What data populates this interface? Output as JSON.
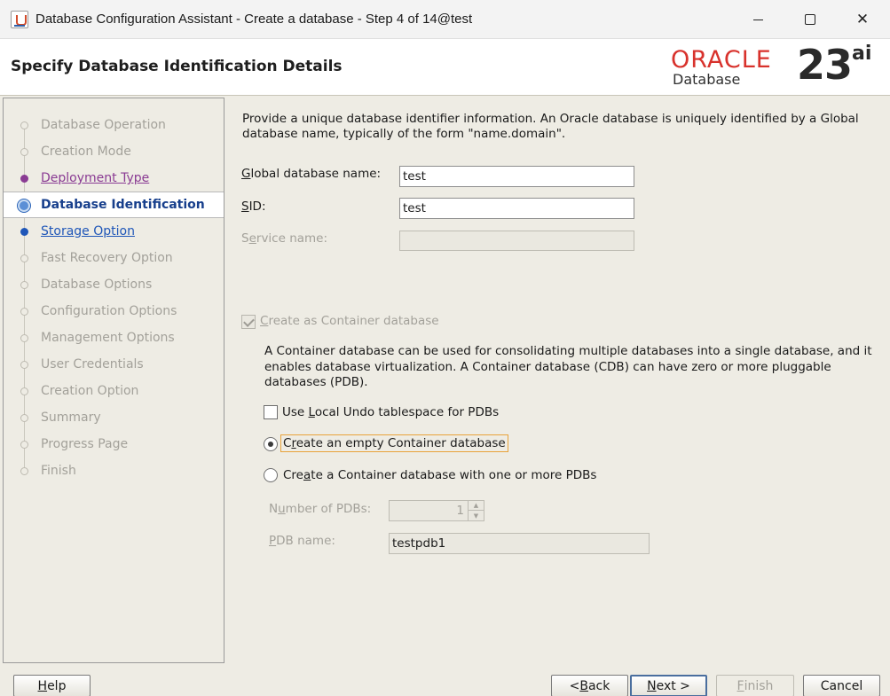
{
  "window": {
    "title": "Database Configuration Assistant - Create a database - Step 4 of 14@test",
    "minimize_glyph": "",
    "close_glyph": "✕"
  },
  "header": {
    "title": "Specify Database Identification Details",
    "logo": {
      "brand": "ORACLE",
      "product": "Database",
      "version": "23",
      "version_suffix": "ai",
      "brand_color": "#d8322c"
    }
  },
  "sidebar": {
    "items": [
      {
        "label": "Database Operation",
        "state": "inactive"
      },
      {
        "label": "Creation Mode",
        "state": "inactive"
      },
      {
        "label": "Deployment Type",
        "state": "visited"
      },
      {
        "label": "Database Identification",
        "state": "current"
      },
      {
        "label": "Storage Option",
        "state": "next"
      },
      {
        "label": "Fast Recovery Option",
        "state": "inactive"
      },
      {
        "label": "Database Options",
        "state": "inactive"
      },
      {
        "label": "Configuration Options",
        "state": "inactive"
      },
      {
        "label": "Management Options",
        "state": "inactive"
      },
      {
        "label": "User Credentials",
        "state": "inactive"
      },
      {
        "label": "Creation Option",
        "state": "inactive"
      },
      {
        "label": "Summary",
        "state": "inactive"
      },
      {
        "label": "Progress Page",
        "state": "inactive"
      },
      {
        "label": "Finish",
        "state": "inactive"
      }
    ]
  },
  "content": {
    "intro": "Provide a unique database identifier information. An Oracle database is uniquely identified by a Global database name, typically of the form \"name.domain\".",
    "global_db_name": {
      "label_mnemonic": "G",
      "label_rest": "lobal database name:",
      "value": "test"
    },
    "sid": {
      "label_mnemonic": "S",
      "label_rest": "ID:",
      "value": "test"
    },
    "service_name": {
      "label_pre": "S",
      "label_mnemonic": "e",
      "label_rest": "rvice name:",
      "value": ""
    },
    "container_checkbox": {
      "label_mnemonic": "C",
      "label_rest": "reate as Container database",
      "checked": true,
      "enabled": false
    },
    "cdb_description": "A Container database can be used for consolidating multiple databases into a single database, and it enables database virtualization. A Container database (CDB) can have zero or more pluggable databases (PDB).",
    "local_undo": {
      "label_pre": "Use ",
      "label_mnemonic": "L",
      "label_rest": "ocal Undo tablespace for PDBs",
      "checked": false
    },
    "radio_empty": {
      "label_pre": "C",
      "label_mnemonic": "r",
      "label_rest": "eate an empty Container database",
      "selected": true
    },
    "radio_pdbs": {
      "label_pre": "Cre",
      "label_mnemonic": "a",
      "label_rest": "te a Container database with one or more PDBs",
      "selected": false
    },
    "num_pdbs": {
      "label_pre": "N",
      "label_mnemonic": "u",
      "label_rest": "mber of PDBs:",
      "value": "1"
    },
    "pdb_name": {
      "label_mnemonic": "P",
      "label_rest": "DB name:",
      "value": "testpdb1"
    }
  },
  "footer": {
    "help": {
      "mnemonic": "H",
      "rest": "elp"
    },
    "back": {
      "pre": "< ",
      "mnemonic": "B",
      "rest": "ack"
    },
    "next": {
      "mnemonic": "N",
      "rest": "ext >"
    },
    "finish": {
      "mnemonic": "F",
      "rest": "inish"
    },
    "cancel": {
      "label": "Cancel"
    }
  }
}
